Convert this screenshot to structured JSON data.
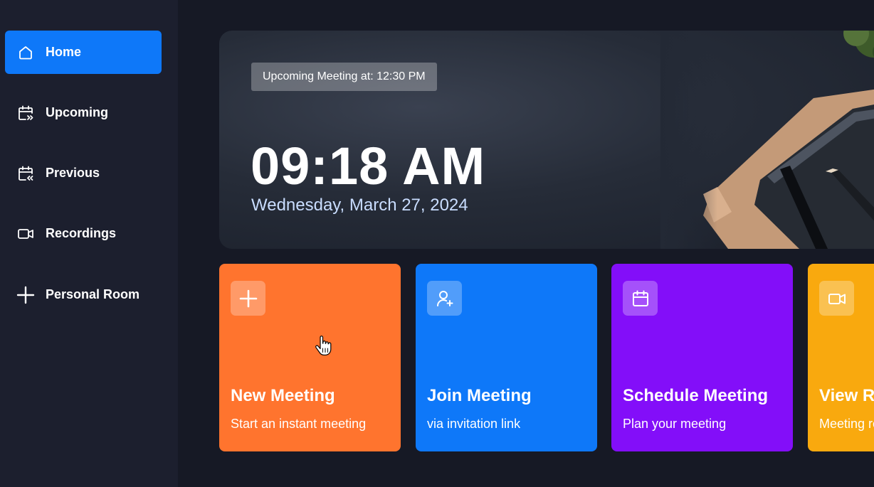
{
  "sidebar": {
    "items": [
      {
        "label": "Home",
        "icon": "home-icon",
        "active": true
      },
      {
        "label": "Upcoming",
        "icon": "calendar-forward-icon",
        "active": false
      },
      {
        "label": "Previous",
        "icon": "calendar-back-icon",
        "active": false
      },
      {
        "label": "Recordings",
        "icon": "video-icon",
        "active": false
      },
      {
        "label": "Personal Room",
        "icon": "plus-icon",
        "active": false
      }
    ]
  },
  "hero": {
    "badge": "Upcoming Meeting at: 12:30 PM",
    "time": "09:18 AM",
    "date": "Wednesday, March 27, 2024"
  },
  "cards": [
    {
      "title": "New Meeting",
      "subtitle": "Start an instant meeting",
      "icon": "plus-icon",
      "color": "#ff742e"
    },
    {
      "title": "Join Meeting",
      "subtitle": "via invitation link",
      "icon": "user-add-icon",
      "color": "#0e78f9"
    },
    {
      "title": "Schedule Meeting",
      "subtitle": "Plan your meeting",
      "icon": "calendar-icon",
      "color": "#830ef9"
    },
    {
      "title": "View Recordings",
      "subtitle": "Meeting recordings",
      "icon": "video-icon",
      "color": "#f9a90e"
    }
  ],
  "colors": {
    "background": "#161925",
    "sidebar": "#1c1f2e",
    "accent": "#0e78f9"
  }
}
